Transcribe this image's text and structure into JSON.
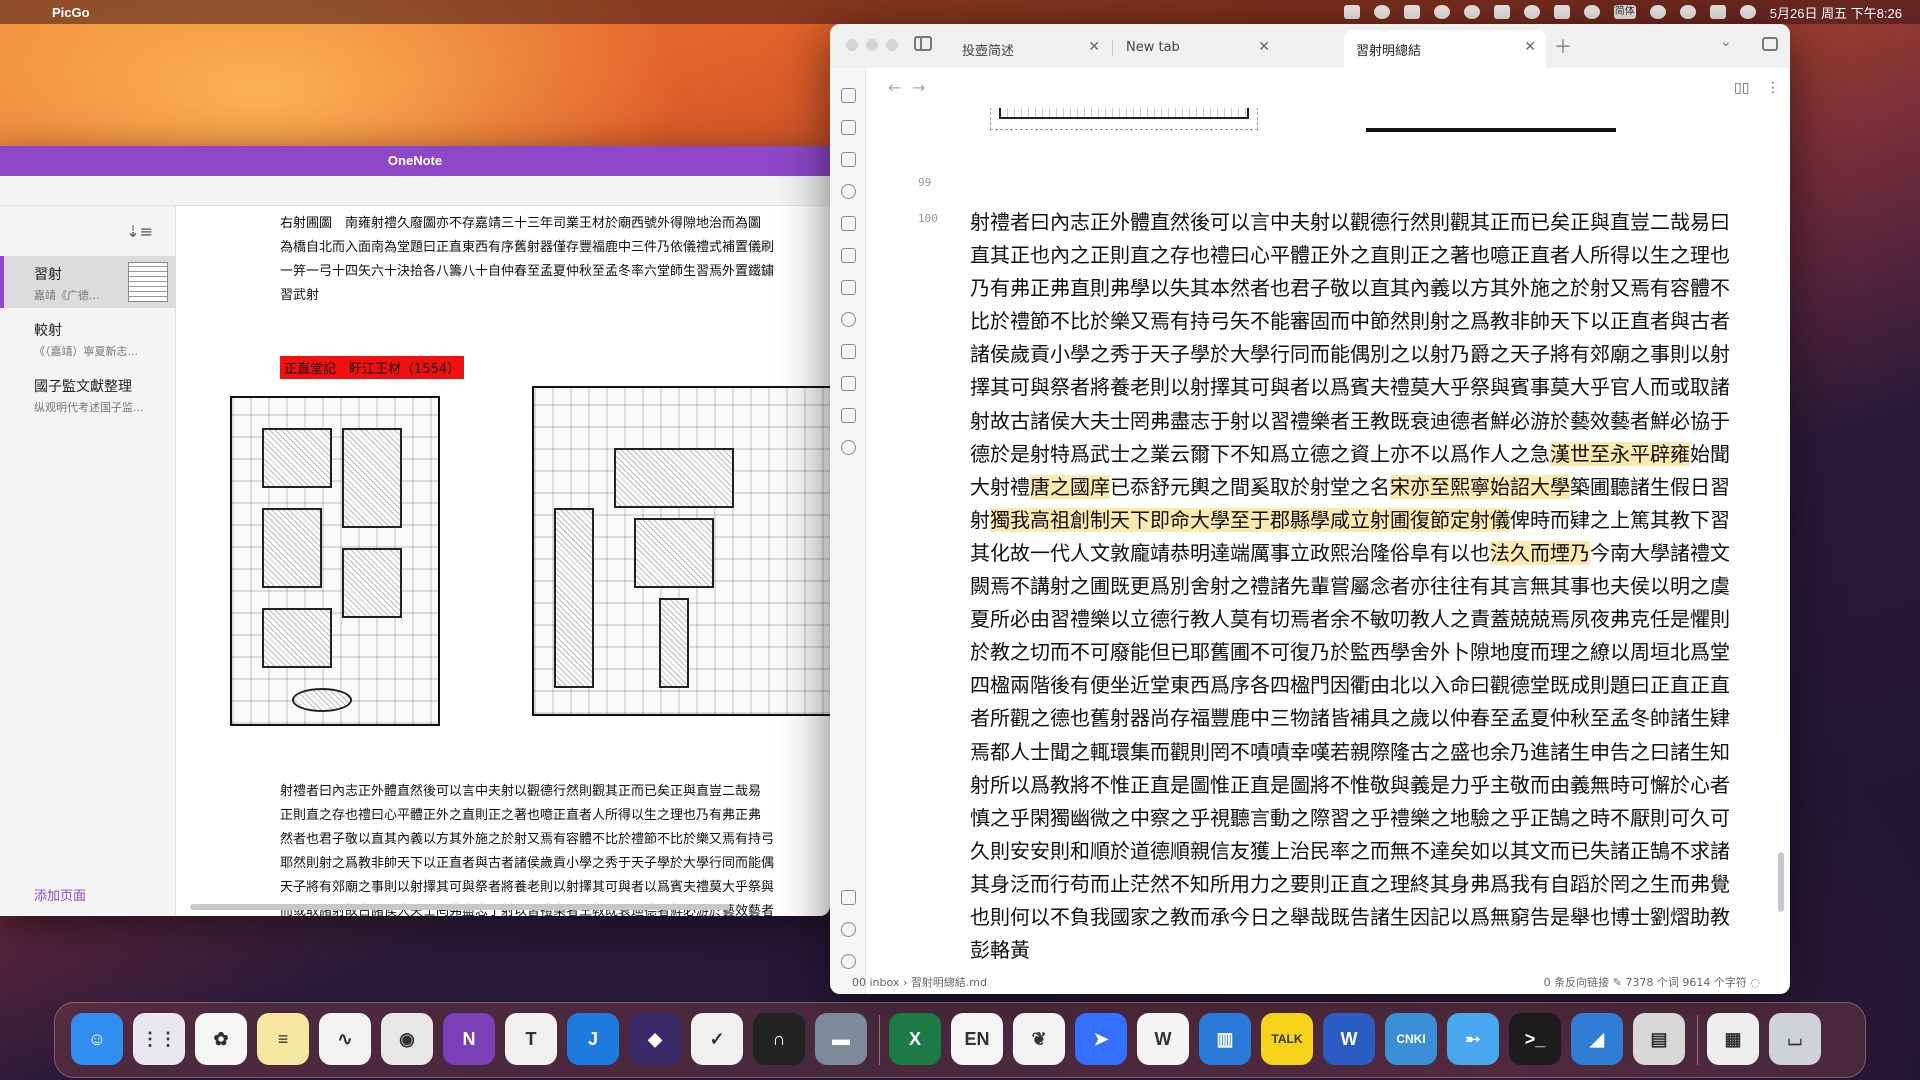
{
  "menubar": {
    "app_name": "PicGo",
    "ime_label": "简体",
    "clock": "5月26日 周五 下午8:26"
  },
  "onenote": {
    "title": "OneNote",
    "pages": [
      {
        "title": "習射",
        "subtitle": "嘉靖《广德..."
      },
      {
        "title": "較射",
        "subtitle": "《（嘉靖）寧夏新志..."
      },
      {
        "title": "國子監文獻整理",
        "subtitle": "纵观明代考述国子监..."
      }
    ],
    "add_page": "添加页面",
    "top_lines": [
      "右射圃圖　南雍射禮久廢圖亦不存嘉靖三十三年司業王材於廟西號外得隙地治而為圖",
      "為橋自北而入面南為堂題曰正直東西有序舊射器僅存豐福鹿中三件乃依儀禮式補置儀刷",
      "一笄一弓十四矢六十決拾各八籌八十自仲春至孟夏仲秋至孟冬率六堂師生習焉外置鐵鏽",
      "習武射"
    ],
    "red_tag": "正直堂記　盱江王材（1554）",
    "bottom_lines": [
      "射禮者曰內志正外體直然後可以言中夫射以觀德行然則觀其正而已矣正與直豈二哉易",
      "正則直之存也禮曰心平體正外之直則正之著也噫正直者人所得以生之理也乃有弗正弗",
      "然者也君子敬以直其內義以方其外施之於射又焉有容體不比於禮節不比於樂又焉有持弓",
      "耶然則射之爲教非帥天下以正直者與古者諸侯歲貢小學之秀于天子學於大學行同而能偶",
      "天子將有郊廟之事則以射擇其可與祭者將養老則以射擇其可與者以爲賓夫禮莫大乎祭與",
      "而或取諸射故古諸侯大夫士罔弗盡志于射以習禮樂者王教既衰迪德者鮮必游於藝效藝者"
    ]
  },
  "obsidian": {
    "tabs": [
      {
        "label": "投壺简述"
      },
      {
        "label": "New tab"
      },
      {
        "label": "習射明總結"
      }
    ],
    "line_numbers": [
      "99",
      "100"
    ],
    "paragraph": [
      {
        "t": "射禮者曰內志正外體直然後可以言中夫射以觀德行然則觀其正而已矣正與直豈二哉易曰直其正也內之正則直之存也禮曰心平體正外之直則正之著也噫正直者人所得以生之理也乃有弗正弗直則弗學以失其本然者也君子敬以直其內義以方其外施之於射又焉有容體不比於禮節不比於樂又焉有持弓矢不能審固而中節然則射之爲教非帥天下以正直者與古者諸侯歲貢小學之秀于天子學於大學行同而能偶別之以射乃爵之天子將有郊廟之事則以射擇其可與祭者將養老則以射擇其可與者以爲賓夫禮莫大乎祭與賓事莫大乎官人而或取諸射故古諸侯大夫士罔弗盡志于射以習禮樂者王教既衰迪德者鮮必游於藝效藝者鮮必協于德於是射特爲武士之業云爾下不知爲立德之資上亦不以爲作人之急",
        "h": false
      },
      {
        "t": "漢世至永平辟雍",
        "h": true
      },
      {
        "t": "始聞大射禮",
        "h": false
      },
      {
        "t": "唐之國庠",
        "h": true
      },
      {
        "t": "已忝舒元輿之間奚取於射堂之名",
        "h": false
      },
      {
        "t": "宋亦至熙寧始詔大學",
        "h": true
      },
      {
        "t": "築圃聽諸生假日習射",
        "h": false
      },
      {
        "t": "獨我高祖創制天下即命大學至于郡縣學咸立射圃復節定射儀",
        "h": true
      },
      {
        "t": "俾時而肄之上篤其教下習其化故一代人文敦龐靖恭明達端厲事立政熙治隆俗阜有以也",
        "h": false
      },
      {
        "t": "法久而堙乃",
        "h": true
      },
      {
        "t": "今南大學諸禮文闕焉不講射之圃既更爲別舍射之禮諸先輩嘗屬念者亦往往有其言無其事也夫侯以明之虞夏所必由習禮樂以立德行教人莫有切焉者余不敏叨教人之責蓋兢兢焉夙夜弗克任是懼則於教之切而不可廢能但已耶舊圃不可復乃於監西學舍外卜隙地度而理之繚以周垣北爲堂四楹兩階後有便坐近堂東西爲序各四楹門因衢由北以入命曰觀德堂既成則題曰正直正直者所觀之德也舊射器尚存福豐鹿中三物諸皆補具之歲以仲春至孟夏仲秋至孟冬帥諸生肄焉都人士聞之輒環集而觀則罔不嘖嘖幸嘆若親際隆古之盛也余乃進諸生申告之曰諸生知射所以爲教將不惟正直是圖惟正直是圖將不惟敬與義是力乎主敬而由義無時可懈於心者慎之乎閑獨幽微之中察之乎視聽言動之際習之乎禮樂之地驗之乎正鵠之時不厭則可久可久則安安則和順於道德順親信友獲上治民率之而無不達矣如以其文而已失諸正鵠不求諸其身泛而行苟而止茫然不知所用力之要則正直之理終其身弗爲我有自蹈於罔之生而弗覺也則何以不負我國家之教而承今日之舉哉既告諸生因記以爲無窮告是舉也博士劉熠助教彭輅黃",
        "h": false
      }
    ],
    "status": {
      "path": "00 inbox",
      "file": "習射明總結.md",
      "backlinks": "0 条反向链接",
      "words": "7378 个词",
      "chars": "9614 个字符"
    }
  },
  "dock": {
    "items": [
      {
        "name": "Finder",
        "color": "#2f8ef0",
        "glyph": "☺"
      },
      {
        "name": "Launchpad",
        "color": "#e8e8ee",
        "glyph": "⋮⋮"
      },
      {
        "name": "Photos",
        "color": "#f5f5f5",
        "glyph": "✿"
      },
      {
        "name": "Notes",
        "color": "#f6e7a0",
        "glyph": "≡"
      },
      {
        "name": "Freeform",
        "color": "#f2f2f2",
        "glyph": "∿"
      },
      {
        "name": "Chrome",
        "color": "#e8e8e8",
        "glyph": "◉"
      },
      {
        "name": "OneNote",
        "color": "#7b3fb8",
        "glyph": "N"
      },
      {
        "name": "Typora",
        "color": "#f0f0f0",
        "glyph": "T"
      },
      {
        "name": "Dict",
        "color": "#1f7ae0",
        "glyph": "J"
      },
      {
        "name": "Obsidian",
        "color": "#3a2a6a",
        "glyph": "◆"
      },
      {
        "name": "Ticktick",
        "color": "#f0f0f0",
        "glyph": "✓"
      },
      {
        "name": "Notion",
        "color": "#222222",
        "glyph": "∩"
      },
      {
        "name": "Folder",
        "color": "#7d8a99",
        "glyph": "▬"
      },
      {
        "name": "Excel",
        "color": "#1e7a45",
        "glyph": "X"
      },
      {
        "name": "EN",
        "color": "#f5f5f5",
        "glyph": "EN"
      },
      {
        "name": "Mindnode",
        "color": "#f2f2f2",
        "glyph": "❦"
      },
      {
        "name": "Lark",
        "color": "#3370ff",
        "glyph": "➤"
      },
      {
        "name": "WPS",
        "color": "#f4f4f4",
        "glyph": "W"
      },
      {
        "name": "Reader",
        "color": "#2a7ad9",
        "glyph": "▥"
      },
      {
        "name": "Talk",
        "color": "#f7d21a",
        "glyph": "TALK"
      },
      {
        "name": "Word",
        "color": "#2b5cc3",
        "glyph": "W"
      },
      {
        "name": "CNKI",
        "color": "#3a8fd6",
        "glyph": "CNKI"
      },
      {
        "name": "Arrow",
        "color": "#4aa8f0",
        "glyph": "➸"
      },
      {
        "name": "Terminal",
        "color": "#1c1c1c",
        "glyph": ">_"
      },
      {
        "name": "Xcode",
        "color": "#2f7dd4",
        "glyph": "◢"
      },
      {
        "name": "Preview",
        "color": "#d8d8d8",
        "glyph": "▤"
      },
      {
        "name": "Stack",
        "color": "#eeeeee",
        "glyph": "▦"
      },
      {
        "name": "Trash",
        "color": "#cfd3d8",
        "glyph": "⌴"
      }
    ]
  }
}
